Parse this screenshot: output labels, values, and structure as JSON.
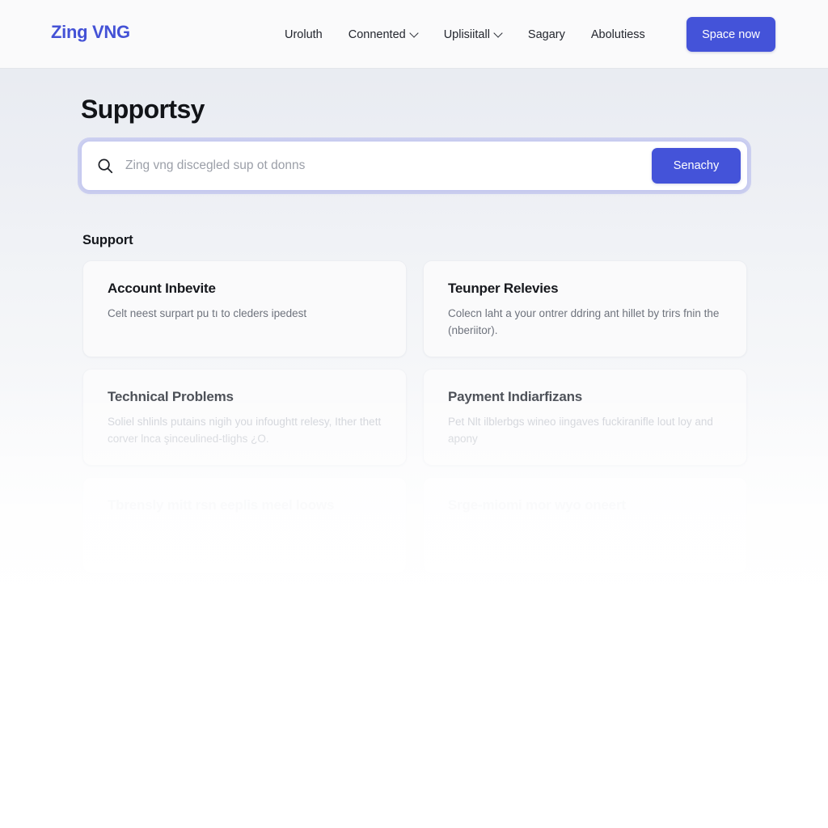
{
  "header": {
    "brand": "Zing VNG",
    "nav": [
      {
        "label": "Uroluth",
        "caret": false
      },
      {
        "label": "Connented",
        "caret": true
      },
      {
        "label": "Uplisiitall",
        "caret": true
      },
      {
        "label": "Sagary",
        "caret": false
      },
      {
        "label": "Abolutiess",
        "caret": false
      }
    ],
    "cta_label": "Space now",
    "accent_color": "#4453d9",
    "brand_color": "#4452d6"
  },
  "main": {
    "page_title": "Supportsy",
    "search": {
      "icon": "search-icon",
      "value": "",
      "placeholder": "Zing vng discegled sup ot donns",
      "button_label": "Senachy"
    },
    "section_title": "Support",
    "cards": [
      {
        "title": "Account Inbevite",
        "desc": "Celt neest surpart pu tı to cleders ipedest",
        "tier": "t1"
      },
      {
        "title": "Teunper Relevies",
        "desc": "Colecn laht a your ontrer ddring ant hillet by trirs fnin the (nberiitor).",
        "tier": "t1"
      },
      {
        "title": "Technical Problems",
        "desc": "Soliel shlinls putains nigih you infoughtt relesy, Ither thett corver lnca şinceulined-tlighs ¿O.",
        "tier": "t2"
      },
      {
        "title": "Payment Indiarfizans",
        "desc": "Pet Nlt ilblerbgs wineo iingaves fuckiranifle lout loy and apony",
        "tier": "t2"
      },
      {
        "title": "Tbrensly mitt rsn eeplis meel loows",
        "desc": "",
        "tier": "t3"
      },
      {
        "title": "Srge-miomi mor wyo oneert",
        "desc": "",
        "tier": "t3"
      },
      {
        "title": "",
        "desc": "",
        "tier": "t4"
      },
      {
        "title": "",
        "desc": "",
        "tier": "t4"
      },
      {
        "title": "",
        "desc": "",
        "tier": "t5"
      },
      {
        "title": "",
        "desc": "",
        "tier": "t5"
      }
    ]
  }
}
